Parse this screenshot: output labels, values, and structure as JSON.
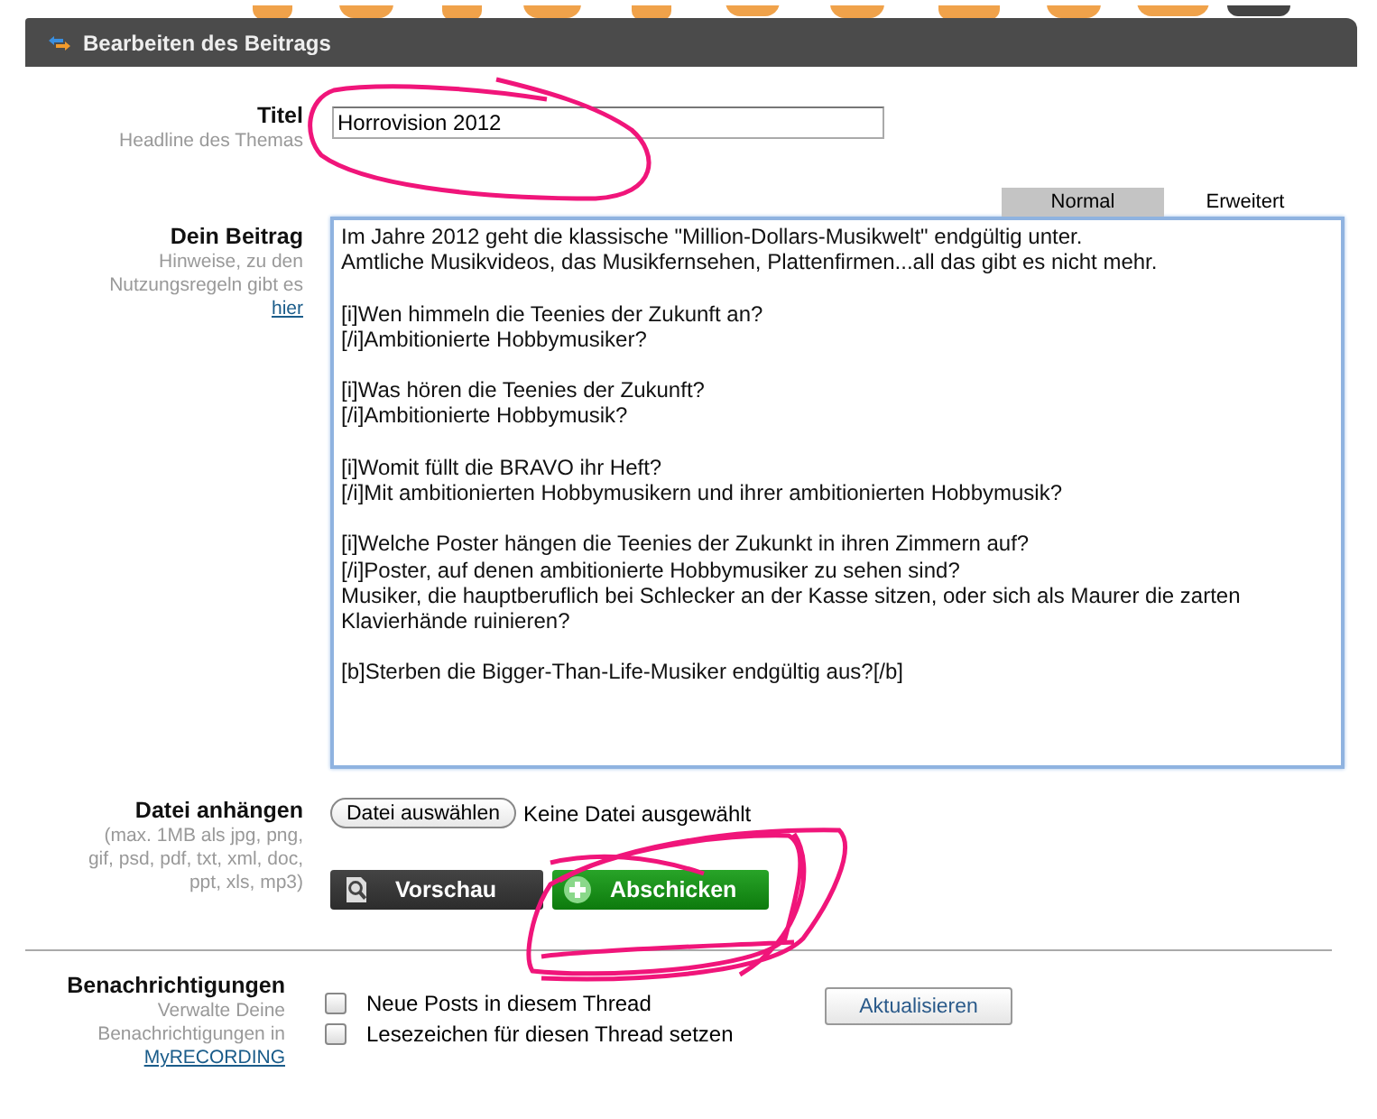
{
  "header": {
    "title": "Bearbeiten des Beitrags"
  },
  "title_field": {
    "label": "Titel",
    "hint": "Headline des Themas",
    "value": "Horrovision 2012"
  },
  "post": {
    "label": "Dein Beitrag",
    "hint": "Hinweise, zu den Nutzungsregeln gibt es",
    "hint_link": "hier",
    "tabs": [
      {
        "label": "Normal",
        "selected": true
      },
      {
        "label": "Erweitert",
        "selected": false
      }
    ],
    "text": "Im Jahre 2012 geht die klassische \"Million-Dollars-Musikwelt\" endgültig unter.\nAmtliche Musikvideos, das Musikfernsehen, Plattenfirmen...all das gibt es nicht mehr.\n\n[i]Wen himmeln die Teenies der Zukunft an?\n[/i]Ambitionierte Hobbymusiker?\n\n[i]Was hören die Teenies der Zukunft?\n[/i]Ambitionierte Hobbymusik?\n\n[i]Womit füllt die BRAVO ihr Heft?\n[/i]Mit ambitionierten Hobbymusikern und ihrer ambitionierten Hobbymusik?\n\n[i]Welche Poster hängen die Teenies der Zukunkt in ihren Zimmern auf?\n[/i]Poster, auf denen ambitionierte Hobbymusiker zu sehen sind?\nMusiker, die hauptberuflich bei Schlecker an der Kasse sitzen, oder sich als Maurer die zarten Klavierhände ruinieren?\n\n[b]Sterben die Bigger-Than-Life-Musiker endgültig aus?[/b]"
  },
  "attachment": {
    "label": "Datei anhängen",
    "hint": "(max. 1MB als jpg, png, gif, psd, pdf, txt, xml, doc, ppt, xls, mp3)",
    "button": "Datei auswählen",
    "status": "Keine Datei ausgewählt"
  },
  "actions": [
    {
      "kind": "preview",
      "label": "Vorschau"
    },
    {
      "kind": "submit",
      "label": "Abschicken"
    }
  ],
  "notifications": {
    "label": "Benachrichtigungen",
    "hint": "Verwalte Deine Benachrichtigungen in",
    "hint_link": "MyRECORDING",
    "options": [
      {
        "label": "Neue Posts in diesem Thread",
        "checked": false
      },
      {
        "label": "Lesezeichen für diesen Thread setzen",
        "checked": false
      }
    ],
    "button": "Aktualisieren"
  }
}
